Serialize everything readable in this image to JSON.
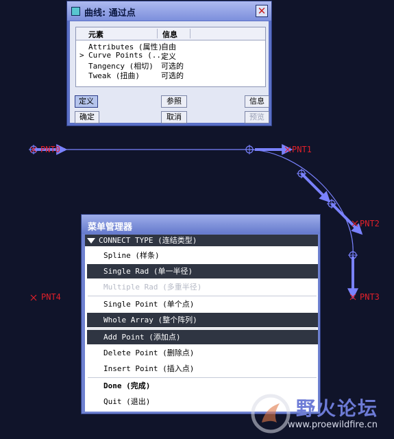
{
  "points": [
    {
      "label": "PNT0"
    },
    {
      "label": "PNT1"
    },
    {
      "label": "PNT2"
    },
    {
      "label": "PNT3"
    },
    {
      "label": "PNT4"
    }
  ],
  "dialog": {
    "title": "曲线: 通过点",
    "close_glyph": "✕",
    "columns": [
      "元素",
      "信息"
    ],
    "rows": [
      {
        "marker": "",
        "element": "Attributes (属性)",
        "info": "自由"
      },
      {
        "marker": ">",
        "element": "Curve Points (...",
        "info": "定义"
      },
      {
        "marker": "",
        "element": "Tangency (相切)",
        "info": "可选的"
      },
      {
        "marker": "",
        "element": "Tweak (扭曲)",
        "info": "可选的"
      }
    ],
    "buttons": {
      "define": "定义",
      "reference": "参照",
      "info": "信息",
      "ok": "确定",
      "cancel": "取消",
      "preview": "预览"
    }
  },
  "menu_manager": {
    "title": "菜单管理器",
    "header": "CONNECT TYPE (连结类型)",
    "items": [
      {
        "label": "Spline (样条)",
        "state": "normal"
      },
      {
        "label": "Single Rad (单一半径)",
        "state": "selected"
      },
      {
        "label": "Multiple Rad (多重半径)",
        "state": "disabled"
      },
      {
        "label": "Single Point (单个点)",
        "state": "normal"
      },
      {
        "label": "Whole Array (整个阵列)",
        "state": "selected"
      },
      {
        "label": "Add Point (添加点)",
        "state": "selected"
      },
      {
        "label": "Delete Point (删除点)",
        "state": "normal"
      },
      {
        "label": "Insert Point (插入点)",
        "state": "normal"
      },
      {
        "label": "Done (完成)",
        "state": "bold"
      },
      {
        "label": "Quit (退出)",
        "state": "normal"
      }
    ]
  },
  "watermark": {
    "title": "野火论坛",
    "url": "www.proewildfire.cn"
  },
  "colors": {
    "curve": "#7a82ff",
    "point_marker": "#e0202a",
    "background": "#10142a"
  }
}
